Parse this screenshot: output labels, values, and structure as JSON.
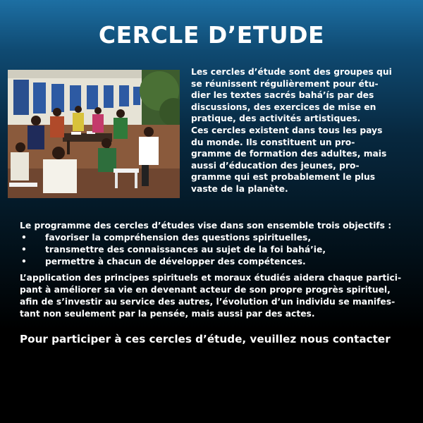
{
  "title": "CERCLE D’ETUDE",
  "photo": {
    "description_icon": "study-circle-photo"
  },
  "intro": {
    "lines": [
      "Les cercles d’étude sont des groupes qui",
      "se réunissent régulièrement pour étu-",
      "dier les textes sacrés bahá’ís par des",
      "discussions, des exercices de mise en",
      "pratique, des activités artistiques.",
      "Ces cercles existent dans tous les pays",
      "du monde. Ils constituent un pro-",
      "gramme de formation des adultes, mais",
      "aussi d’éducation des jeunes, pro-",
      "gramme qui est probablement le plus",
      "vaste de la planète."
    ]
  },
  "goals": {
    "lead": "Le programme des cercles d’études  vise dans son ensemble trois objectifs :",
    "bullet_symbol": "•",
    "items": [
      "favoriser la compréhension des questions spirituelles,",
      "transmettre des connaissances au sujet de la foi bahá’ie,",
      "permettre à chacun de développer des compétences."
    ]
  },
  "application": {
    "lines": [
      "L’application des principes spirituels et moraux étudiés aidera chaque partici-",
      "pant à améliorer sa vie en devenant acteur de son propre progrès spirituel,",
      "afin de s’investir au service des autres, l’évolution d’un individu se manifes-",
      "tant non seulement par la pensée, mais aussi par des actes."
    ]
  },
  "contact": "Pour participer à ces cercles d’étude, veuillez nous contacter",
  "colors": {
    "background_top": "#1d6fa3",
    "background_bottom": "#000000",
    "text": "#ffffff"
  }
}
